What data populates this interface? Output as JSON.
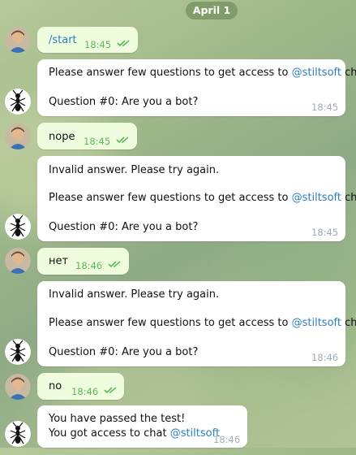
{
  "date_label": "April 1",
  "colors": {
    "outgoing": "#effdde",
    "incoming": "#ffffff",
    "link": "#2b7ec0",
    "read_ticks": "#5eb85e"
  },
  "messages": [
    {
      "dir": "out",
      "text": "/start",
      "time": "18:45",
      "status": "read"
    },
    {
      "dir": "in",
      "lines": [
        {
          "prefix": "Please answer few questions to get access to ",
          "mention": "@stiltsoft",
          "suffix": " chat"
        },
        {
          "text": "Question #0: Are you a bot?"
        }
      ],
      "time": "18:45"
    },
    {
      "dir": "out",
      "text": "nope",
      "time": "18:45",
      "status": "read"
    },
    {
      "dir": "in",
      "lines": [
        {
          "text": "Invalid answer. Please try again."
        },
        {
          "prefix": "Please answer few questions to get access to ",
          "mention": "@stiltsoft",
          "suffix": " chat"
        },
        {
          "text": "Question #0: Are you a bot?"
        }
      ],
      "time": "18:45"
    },
    {
      "dir": "out",
      "text": "нет",
      "time": "18:46",
      "status": "read"
    },
    {
      "dir": "in",
      "lines": [
        {
          "text": "Invalid answer. Please try again."
        },
        {
          "prefix": "Please answer few questions to get access to ",
          "mention": "@stiltsoft",
          "suffix": " chat"
        },
        {
          "text": "Question #0: Are you a bot?"
        }
      ],
      "time": "18:46"
    },
    {
      "dir": "out",
      "text": "no",
      "time": "18:46",
      "status": "read"
    },
    {
      "dir": "in",
      "lines": [
        {
          "text": "You have passed the test!"
        },
        {
          "prefix": "You got access to chat ",
          "mention": "@stiltsoft",
          "suffix": ""
        }
      ],
      "time": "18:46"
    }
  ]
}
